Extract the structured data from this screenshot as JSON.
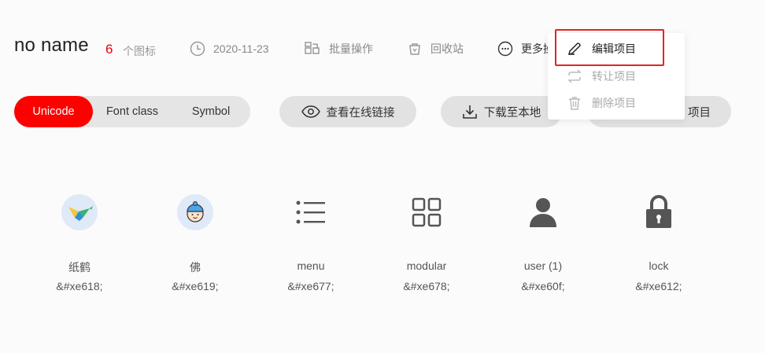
{
  "header": {
    "title": "no name",
    "count": "6",
    "count_label": "个图标",
    "date": "2020-11-23",
    "batch": "批量操作",
    "recycle": "回收站",
    "more": "更多操作"
  },
  "toggle": {
    "unicode": "Unicode",
    "font_class": "Font class",
    "symbol": "Symbol",
    "active": "Unicode"
  },
  "actions": {
    "online_link": "查看在线链接",
    "download": "下载至本地",
    "add": "项目"
  },
  "dropdown": {
    "edit": "编辑项目",
    "transfer": "转让项目",
    "delete": "删除项目"
  },
  "icons": [
    {
      "name": "纸鹤",
      "code": "&#xe618;",
      "icon": "paper-crane-icon"
    },
    {
      "name": "佛",
      "code": "&#xe619;",
      "icon": "buddha-icon"
    },
    {
      "name": "menu",
      "code": "&#xe677;",
      "icon": "menu-icon"
    },
    {
      "name": "modular",
      "code": "&#xe678;",
      "icon": "modular-icon"
    },
    {
      "name": "user (1)",
      "code": "&#xe60f;",
      "icon": "user-icon"
    },
    {
      "name": "lock",
      "code": "&#xe612;",
      "icon": "lock-icon"
    }
  ],
  "colors": {
    "accent": "#fe0000",
    "highlight_border": "#e32521",
    "pill_bg": "#e2e2e2"
  }
}
